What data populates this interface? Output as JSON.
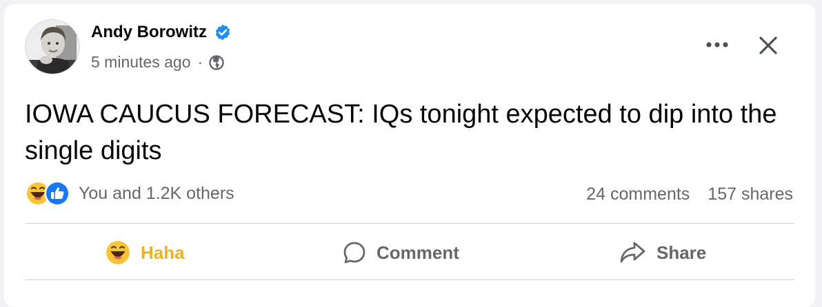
{
  "post": {
    "author": "Andy Borowitz",
    "timestamp": "5 minutes ago",
    "separator": "·",
    "text": "IOWA CAUCUS FORECAST: IQs tonight expected to dip into the single digits"
  },
  "icons": {
    "verified": "verified-badge-icon",
    "privacy": "globe-icon",
    "more": "more-icon",
    "close": "close-icon",
    "reaction_1": "haha-icon",
    "reaction_2": "like-icon",
    "comment": "comment-icon",
    "share": "share-icon"
  },
  "engagement": {
    "reactions_text": "You and 1.2K others",
    "comments": "24 comments",
    "shares": "157 shares"
  },
  "actions": {
    "reaction_label": "Haha",
    "comment_label": "Comment",
    "share_label": "Share"
  },
  "colors": {
    "verified": "#1d8df2",
    "haha": "#f0b127",
    "like": "#1877f2",
    "secondary_text": "#65676b"
  }
}
